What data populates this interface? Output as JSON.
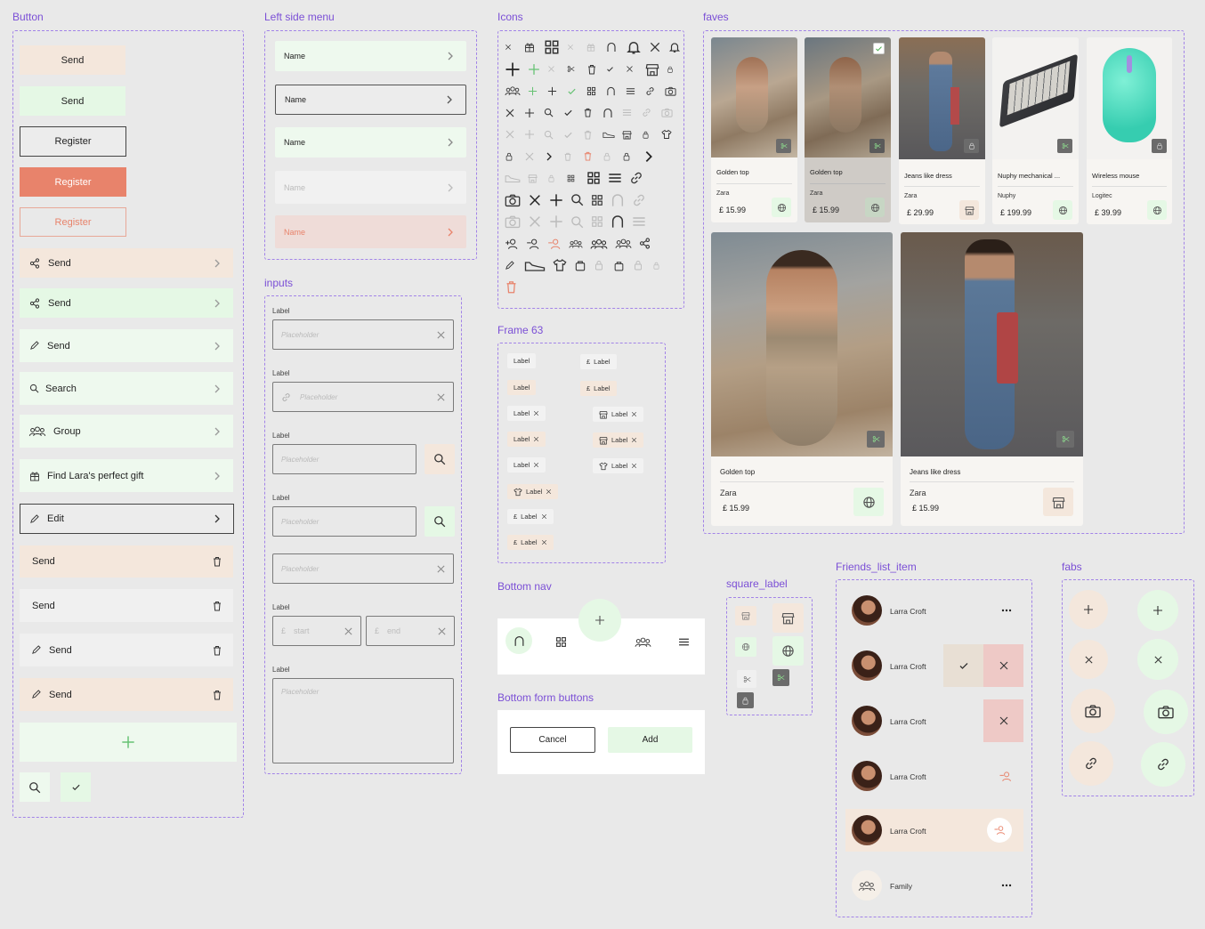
{
  "frames": {
    "button": "Button",
    "menu": "Left side menu",
    "icons": "Icons",
    "faves": "faves",
    "inputs": "inputs",
    "frame63": "Frame 63",
    "bottom_nav": "Bottom nav",
    "square_label": "square_label",
    "friends": "Friends_list_item",
    "form_buttons": "Bottom form buttons",
    "fabs": "fabs"
  },
  "buttons": {
    "send1": "Send",
    "send2": "Send",
    "register1": "Register",
    "register2": "Register",
    "register3": "Register",
    "share_send1": "Send",
    "share_send2": "Send",
    "edit_send": "Send",
    "search": "Search",
    "group": "Group",
    "gift": "Find Lara's perfect gift",
    "edit": "Edit",
    "del_send1": "Send",
    "del_send2": "Send",
    "del_send3": "Send",
    "del_send4": "Send"
  },
  "menu": {
    "items": [
      "Name",
      "Name",
      "Name",
      "Name",
      "Name"
    ]
  },
  "inputs": {
    "label": "Label",
    "placeholder": "Placeholder",
    "start": "start",
    "end": "end",
    "currency": "£"
  },
  "frame63": {
    "chip_label": "Label",
    "currency": "£"
  },
  "faves": {
    "cards": [
      {
        "title": "Golden top",
        "brand": "Zara",
        "price": "£ 15.99"
      },
      {
        "title": "Golden top",
        "brand": "Zara",
        "price": "£ 15.99"
      },
      {
        "title": "Jeans like dress",
        "brand": "Zara",
        "price": "£ 29.99"
      },
      {
        "title": "Nuphy mechanical ...",
        "brand": "Nuphy",
        "price": "£ 199.99"
      },
      {
        "title": "Wireless mouse",
        "brand": "Logitec",
        "price": "£ 39.99"
      },
      {
        "title": "Golden top",
        "brand": "Zara",
        "price": "£ 15.99"
      },
      {
        "title": "Jeans like dress",
        "brand": "Zara",
        "price": "£ 15.99"
      }
    ]
  },
  "form_buttons": {
    "cancel": "Cancel",
    "add": "Add"
  },
  "friends": {
    "items": [
      "Larra Croft",
      "Larra Croft",
      "Larra Croft",
      "Larra Croft",
      "Larra Croft",
      "Family"
    ],
    "more": "•••"
  },
  "colors": {
    "accent": "#7b4fd6",
    "mint": "#e5f8e5",
    "peach": "#f4e7dc",
    "coral": "#e8836b",
    "pink": "#eec9c6"
  }
}
